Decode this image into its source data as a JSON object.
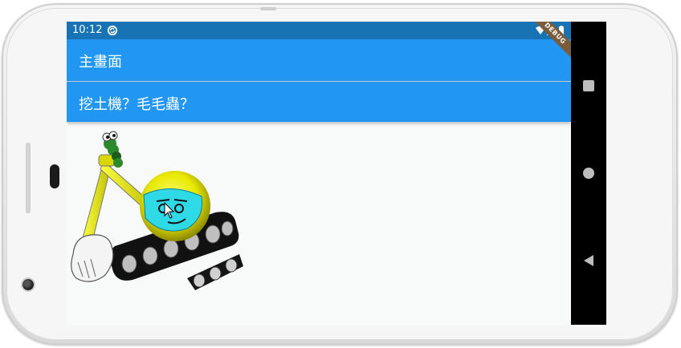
{
  "status_bar": {
    "time": "10:12",
    "sync_icon": "sync-icon",
    "wifi_icon": "wifi-icon",
    "signal_icon": "signal-icon",
    "battery_icon": "battery-icon"
  },
  "app_bar": {
    "title": "主畫面"
  },
  "header": {
    "text": "挖土機？毛毛蟲？"
  },
  "debug_banner": "DEBUG",
  "nav_bar": {
    "square_icon": "overview-square-icon",
    "circle_icon": "home-circle-icon",
    "triangle_icon": "back-triangle-icon"
  },
  "colors": {
    "status_bar": "#1873b4",
    "app_bar": "#2196f3",
    "body_bg": "#f8f9f9",
    "nav_bar": "#000000"
  }
}
